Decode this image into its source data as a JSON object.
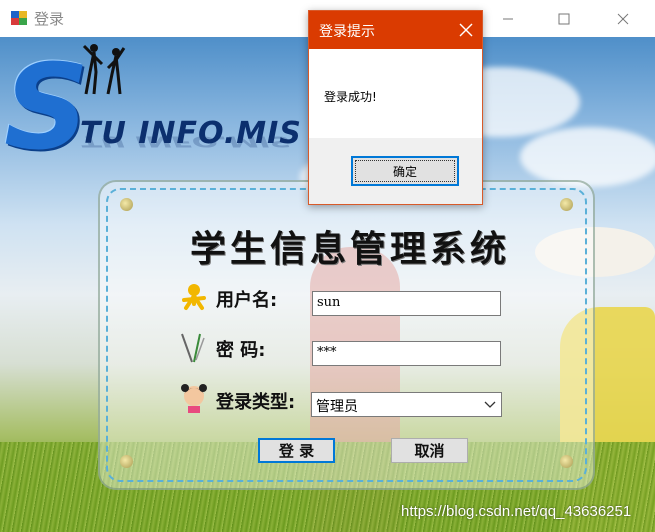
{
  "window": {
    "title": "登录",
    "min_symbol": "—",
    "close_symbol": "✕"
  },
  "logo": {
    "big_letter": "S",
    "text": "TU INFO.MIS"
  },
  "form": {
    "system_title": "学生信息管理系统",
    "username_label": "用户名:",
    "username_value": "sun",
    "password_label": "密  码:",
    "password_value": "***",
    "role_label": "登录类型:",
    "role_value": "管理员",
    "login_button": "登 录",
    "cancel_button": "取消"
  },
  "dialog": {
    "title": "登录提示",
    "message": "登录成功!",
    "ok_button": "确定"
  },
  "watermark": "https://blog.csdn.net/qq_43636251",
  "colors": {
    "dialog_titlebar": "#da3b01",
    "focus_border": "#0078d7",
    "logo_blue": "#1f6fd1"
  },
  "icons": [
    "app-icon",
    "minimize-icon",
    "maximize-icon",
    "close-icon",
    "user-icon",
    "key-icon",
    "avatar-icon",
    "chevron-down-icon"
  ]
}
